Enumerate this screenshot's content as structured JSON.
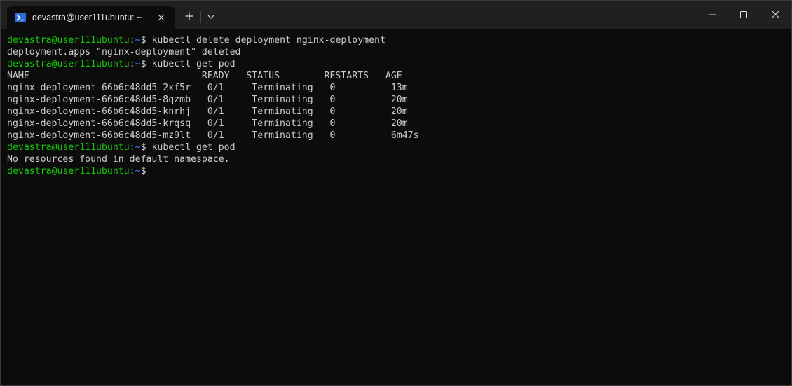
{
  "window": {
    "tab_title": "devastra@user111ubuntu: ~",
    "tab_icon": "powershell-terminal-icon",
    "new_tab_icon": "plus-icon",
    "dropdown_icon": "chevron-down-icon",
    "minimize_icon": "minimize-icon",
    "maximize_icon": "maximize-icon",
    "close_icon": "close-icon"
  },
  "colors": {
    "background": "#0c0c0c",
    "titlebar": "#202020",
    "prompt_user": "#16c60c",
    "prompt_path": "#3b78ff",
    "text": "#cccccc"
  },
  "terminal": {
    "prompt": {
      "user_host": "devastra@user111ubuntu",
      "colon": ":",
      "path": "~",
      "symbol": "$"
    },
    "lines": [
      {
        "type": "cmd",
        "command": " kubectl delete deployment nginx-deployment"
      },
      {
        "type": "out",
        "text": "deployment.apps \"nginx-deployment\" deleted"
      },
      {
        "type": "cmd",
        "command": " kubectl get pod"
      },
      {
        "type": "out",
        "text": "NAME                               READY   STATUS        RESTARTS   AGE"
      },
      {
        "type": "out",
        "text": "nginx-deployment-66b6c48dd5-2xf5r   0/1     Terminating   0          13m"
      },
      {
        "type": "out",
        "text": "nginx-deployment-66b6c48dd5-8qzmb   0/1     Terminating   0          20m"
      },
      {
        "type": "out",
        "text": "nginx-deployment-66b6c48dd5-knrhj   0/1     Terminating   0          20m"
      },
      {
        "type": "out",
        "text": "nginx-deployment-66b6c48dd5-krqsq   0/1     Terminating   0          20m"
      },
      {
        "type": "out",
        "text": "nginx-deployment-66b6c48dd5-mz9lt   0/1     Terminating   0          6m47s"
      },
      {
        "type": "cmd",
        "command": " kubectl get pod"
      },
      {
        "type": "out",
        "text": "No resources found in default namespace."
      },
      {
        "type": "cmd",
        "command": " ",
        "cursor": true
      }
    ]
  }
}
